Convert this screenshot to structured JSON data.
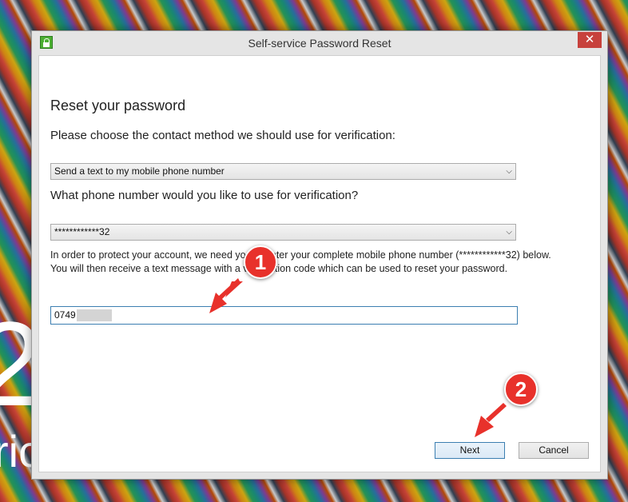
{
  "window": {
    "title": "Self-service Password Reset",
    "close_glyph": "✕"
  },
  "form": {
    "heading": "Reset your password",
    "contact_question": "Please choose the contact method we should use for verification:",
    "contact_selected": "Send a text to my mobile phone number",
    "phone_question": "What phone number would you like to use for verification?",
    "phone_selected": "************32",
    "info_text": "In order to protect your account, we need you to enter your complete mobile phone number (************32) below. You will then receive a text message with a verification code which can be used to reset your password.",
    "phone_value": "0749"
  },
  "buttons": {
    "next": "Next",
    "cancel": "Cancel"
  },
  "annotations": {
    "step1": "1",
    "step2": "2",
    "accent_color": "#e8312b"
  },
  "desktop": {
    "glyph": "2",
    "text": "ric"
  }
}
